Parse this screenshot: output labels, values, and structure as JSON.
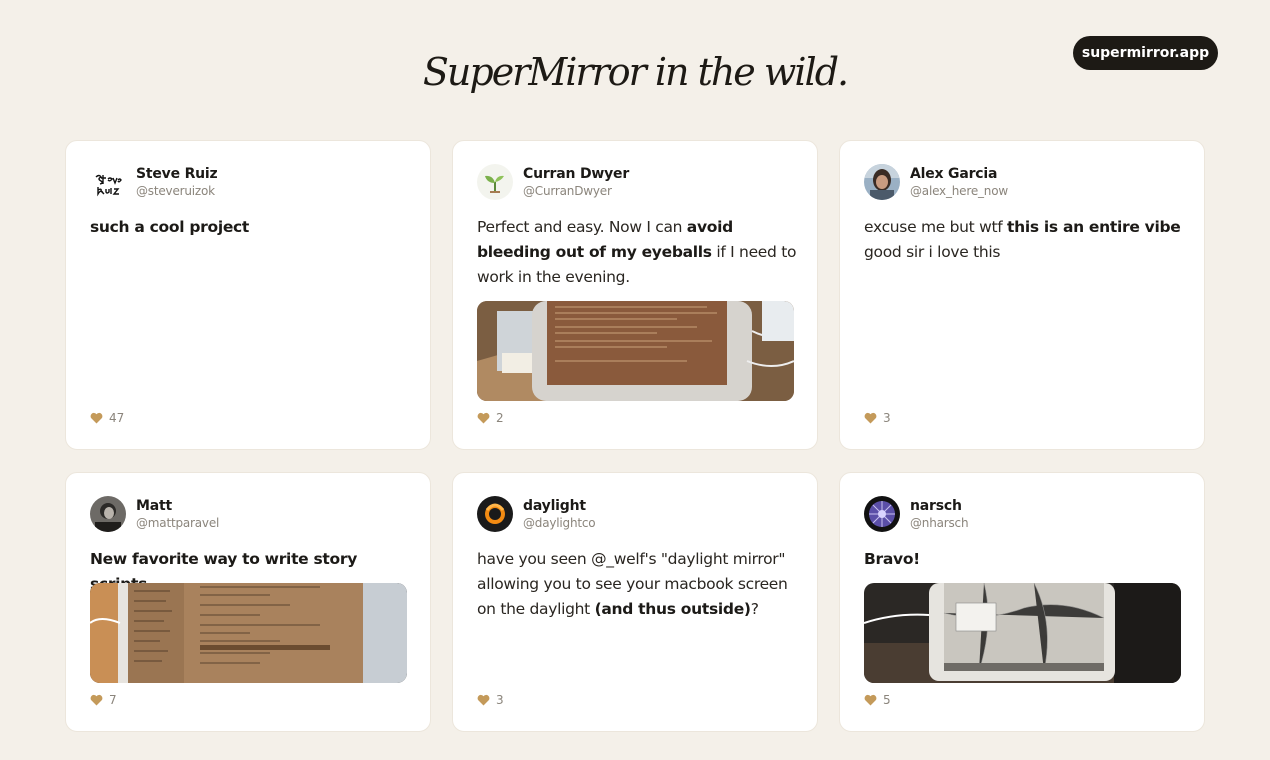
{
  "header": {
    "title": "SuperMirror in the wild.",
    "cta_label": "supermirror.app"
  },
  "colors": {
    "background": "#f4f0e9",
    "cta": "#1d1a15",
    "heart": "#c49a5a"
  },
  "posts": [
    {
      "name": "Steve Ruiz",
      "handle": "@steveruizok",
      "text_parts": [
        "such a cool project"
      ],
      "likes": "47"
    },
    {
      "name": "Curran Dwyer",
      "handle": "@CurranDwyer",
      "text_parts": [
        "Perfect and easy. Now I can ",
        "avoid bleeding out of my eyeballs",
        " if I need to work in the evening."
      ],
      "likes": "2"
    },
    {
      "name": "Alex Garcia",
      "handle": "@alex_here_now",
      "text_parts": [
        "excuse me but wtf ",
        "this is an entire vibe",
        " good sir i love this"
      ],
      "likes": "3"
    },
    {
      "name": "Matt",
      "handle": "@mattparavel",
      "text_parts": [
        "New favorite way to write story scripts"
      ],
      "likes": "7"
    },
    {
      "name": "daylight",
      "handle": "@daylightco",
      "text_parts": [
        "have you seen @_welf's \"daylight mirror\" allowing you to see your macbook screen on the daylight ",
        "(and thus outside)",
        "?"
      ],
      "likes": "3"
    },
    {
      "name": "narsch",
      "handle": "@nharsch",
      "text_parts": [
        "Bravo!"
      ],
      "likes": "5"
    }
  ]
}
